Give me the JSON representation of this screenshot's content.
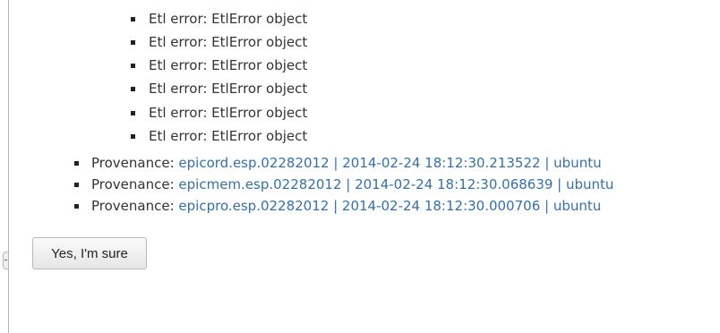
{
  "errors": [
    {
      "text": "Etl error: EtlError object"
    },
    {
      "text": "Etl error: EtlError object"
    },
    {
      "text": "Etl error: EtlError object"
    },
    {
      "text": "Etl error: EtlError object"
    },
    {
      "text": "Etl error: EtlError object"
    },
    {
      "text": "Etl error: EtlError object"
    }
  ],
  "provenance": [
    {
      "label": "Provenance:",
      "link": "epicord.esp.02282012 | 2014-02-24 18:12:30.213522 | ubuntu"
    },
    {
      "label": "Provenance:",
      "link": "epicmem.esp.02282012 | 2014-02-24 18:12:30.068639 | ubuntu"
    },
    {
      "label": "Provenance:",
      "link": "epicpro.esp.02282012 | 2014-02-24 18:12:30.000706 | ubuntu"
    }
  ],
  "confirm_button": {
    "label": "Yes, I'm sure"
  },
  "colors": {
    "link": "#3570a8",
    "text": "#333333",
    "rule": "#b5b5b5"
  }
}
